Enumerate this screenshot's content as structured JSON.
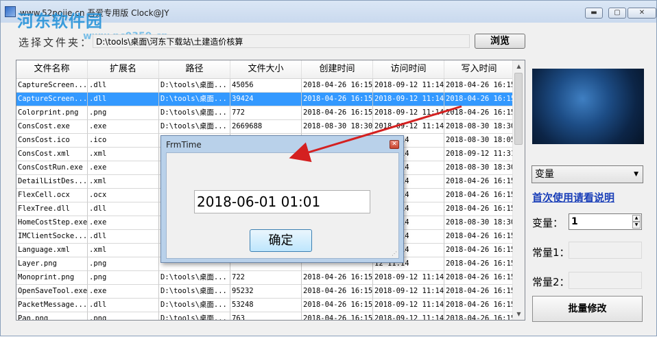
{
  "window": {
    "title": "www.52pojie.cn 吾爱专用版 Clock@JY",
    "min_icon": "minimize-icon",
    "max_icon": "maximize-icon",
    "close_icon": "close-icon"
  },
  "watermark": {
    "text": "河东软件园",
    "url": "www.pc0359.cn"
  },
  "toolbar": {
    "folder_label": "选择文件夹：",
    "folder_path": "D:\\tools\\桌面\\河东下载站\\土建造价核算",
    "browse_label": "浏览"
  },
  "grid": {
    "columns": [
      "文件名称",
      "扩展名",
      "路径",
      "文件大小",
      "创建时间",
      "访问时间",
      "写入时间"
    ],
    "selected_row": 1,
    "rows": [
      [
        "CaptureScreen...",
        ".dll",
        "D:\\tools\\桌面...",
        "45056",
        "2018-04-26 16:15",
        "2018-09-12 11:14",
        "2018-04-26 16:15"
      ],
      [
        "CaptureScreen...",
        ".dll",
        "D:\\tools\\桌面...",
        "39424",
        "2018-04-26 16:15",
        "2018-09-12 11:14",
        "2018-04-26 16:15"
      ],
      [
        "Colorprint.png",
        ".png",
        "D:\\tools\\桌面...",
        "772",
        "2018-04-26 16:15",
        "2018-09-12 11:14",
        "2018-04-26 16:15"
      ],
      [
        "ConsCost.exe",
        ".exe",
        "D:\\tools\\桌面...",
        "2669688",
        "2018-08-30 18:30",
        "2018-09-12 11:14",
        "2018-08-30 18:30"
      ],
      [
        "ConsCost.ico",
        ".ico",
        "",
        "",
        "",
        "12 11:14",
        "2018-08-30 18:05"
      ],
      [
        "ConsCost.xml",
        ".xml",
        "",
        "",
        "",
        "12 11:14",
        "2018-09-12 11:31"
      ],
      [
        "ConsCostRun.exe",
        ".exe",
        "",
        "",
        "",
        "12 11:14",
        "2018-08-30 18:30"
      ],
      [
        "DetailListDes...",
        ".xml",
        "",
        "",
        "",
        "12 11:14",
        "2018-04-26 16:15"
      ],
      [
        "FlexCell.ocx",
        ".ocx",
        "",
        "",
        "",
        "12 11:14",
        "2018-04-26 16:15"
      ],
      [
        "FlexTree.dll",
        ".dll",
        "",
        "",
        "",
        "12 11:14",
        "2018-04-26 16:15"
      ],
      [
        "HomeCostStep.exe",
        ".exe",
        "",
        "",
        "",
        "12 11:14",
        "2018-08-30 18:30"
      ],
      [
        "IMClientSocke...",
        ".dll",
        "",
        "",
        "",
        "12 11:14",
        "2018-04-26 16:15"
      ],
      [
        "Language.xml",
        ".xml",
        "",
        "",
        "",
        "12 11:14",
        "2018-04-26 16:15"
      ],
      [
        "Layer.png",
        ".png",
        "",
        "",
        "",
        "12 11:14",
        "2018-04-26 16:15"
      ],
      [
        "Monoprint.png",
        ".png",
        "D:\\tools\\桌面...",
        "722",
        "2018-04-26 16:15",
        "2018-09-12 11:14",
        "2018-04-26 16:15"
      ],
      [
        "OpenSaveTool.exe",
        ".exe",
        "D:\\tools\\桌面...",
        "95232",
        "2018-04-26 16:15",
        "2018-09-12 11:14",
        "2018-04-26 16:15"
      ],
      [
        "PacketMessage...",
        ".dll",
        "D:\\tools\\桌面...",
        "53248",
        "2018-04-26 16:15",
        "2018-09-12 11:14",
        "2018-04-26 16:15"
      ],
      [
        "Pan.png",
        ".png",
        "D:\\tools\\桌面...",
        "763",
        "2018-04-26 16:15",
        "2018-09-12 11:14",
        "2018-04-26 16:15"
      ]
    ]
  },
  "side": {
    "mode_select": "变量",
    "help_link": "首次使用请看说明",
    "variable_label": "变量：",
    "variable_value": "1",
    "const1_label": "常量1：",
    "const2_label": "常量2：",
    "batch_button": "批量修改"
  },
  "dialog": {
    "title": "FrmTime",
    "time_value": "2018-06-01 01:01",
    "ok_label": "确定"
  },
  "colors": {
    "selection": "#3399ff",
    "link": "#1a3fb8",
    "arrow": "#d42020"
  }
}
